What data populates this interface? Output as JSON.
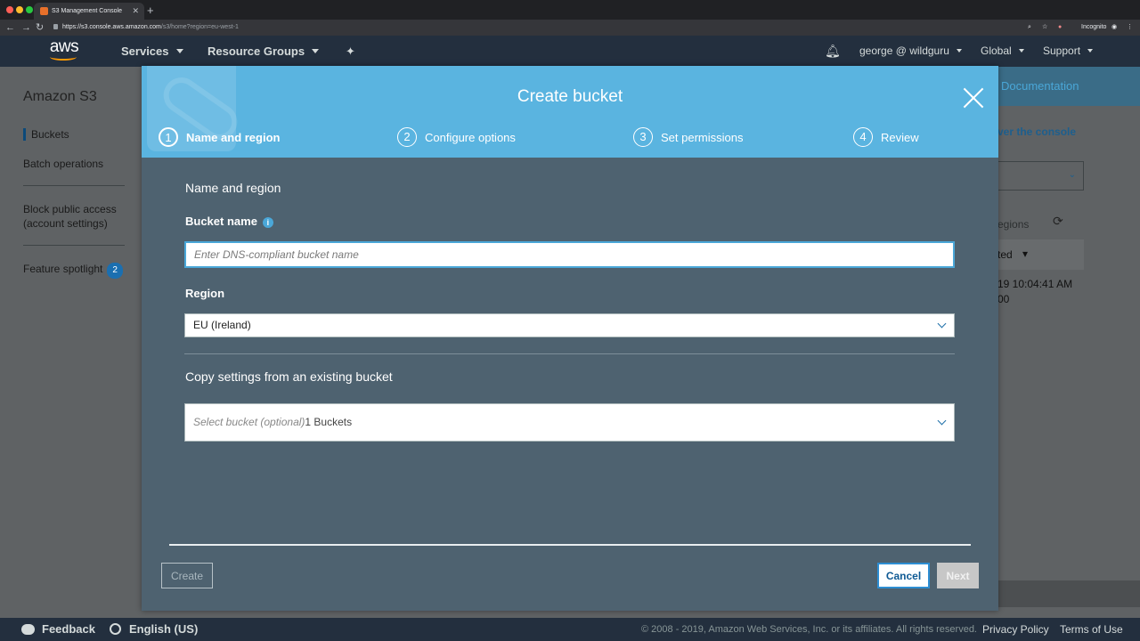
{
  "browser": {
    "tab_title": "S3 Management Console",
    "new_tab": "+",
    "url_host": "https://s3.console.aws.amazon.com",
    "url_path": "/s3/home?region=eu-west-1",
    "incognito": "Incognito"
  },
  "header": {
    "logo": "aws",
    "services": "Services",
    "resource_groups": "Resource Groups",
    "user": "george @ wildguru",
    "region": "Global",
    "support": "Support"
  },
  "sidebar": {
    "title": "Amazon S3",
    "items": [
      {
        "label": "Buckets"
      },
      {
        "label": "Batch operations"
      },
      {
        "label": "Block public access\n(account settings)"
      },
      {
        "label": "Feature spotlight",
        "badge": "2"
      }
    ]
  },
  "background": {
    "documentation": "Documentation",
    "console_link": "ver the console",
    "regions_text": "egions",
    "column_header": "ted",
    "date_cell": "19 10:04:41 AM",
    "date_cell_2": "00"
  },
  "modal": {
    "title": "Create bucket",
    "steps": [
      {
        "num": "1",
        "label": "Name and region"
      },
      {
        "num": "2",
        "label": "Configure options"
      },
      {
        "num": "3",
        "label": "Set permissions"
      },
      {
        "num": "4",
        "label": "Review"
      }
    ],
    "section_title": "Name and region",
    "bucket_name_label": "Bucket name",
    "bucket_name_placeholder": "Enter DNS-compliant bucket name",
    "bucket_name_value": "",
    "region_label": "Region",
    "region_value": "EU (Ireland)",
    "copy_title": "Copy settings from an existing bucket",
    "copy_placeholder": "Select bucket (optional)",
    "copy_count": "1 Buckets",
    "buttons": {
      "create": "Create",
      "cancel": "Cancel",
      "next": "Next"
    }
  },
  "footer": {
    "feedback": "Feedback",
    "language": "English (US)",
    "copyright": "© 2008 - 2019, Amazon Web Services, Inc. or its affiliates. All rights reserved.",
    "privacy": "Privacy Policy",
    "terms": "Terms of Use"
  },
  "colors": {
    "aws_header": "#232f3e",
    "modal_header": "#5ab4e0",
    "modal_body": "#4e6270",
    "accent_orange": "#ff9900",
    "link_blue": "#2d8ed3"
  }
}
